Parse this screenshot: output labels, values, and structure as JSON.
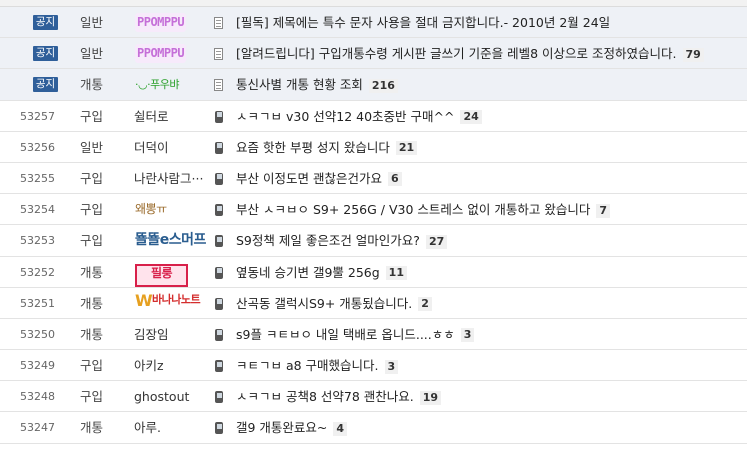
{
  "notices": [
    {
      "badge": "공지",
      "category": "일반",
      "nickname": "PPOMPPU",
      "nick_style": "ppo",
      "icon": "doc-icon",
      "title": "[필독] 제목에는 특수 문자 사용을 절대 금지합니다.- 2010년 2월 24일",
      "comments": ""
    },
    {
      "badge": "공지",
      "category": "일반",
      "nickname": "PPOMPPU",
      "nick_style": "ppo",
      "icon": "doc-icon",
      "title": "[알려드립니다] 구입개통수령 게시판 글쓰기 기준을 레벨8 이상으로 조정하였습니다.",
      "comments": "79"
    },
    {
      "badge": "공지",
      "category": "개통",
      "nickname": "·◡·푸우뱌",
      "nick_style": "emo",
      "icon": "doc-icon",
      "title": "통신사별 개통 현황 조회",
      "comments": "216"
    }
  ],
  "posts": [
    {
      "number": "53257",
      "category": "구입",
      "author": "쉴터로",
      "nick_style": "",
      "title": "ㅅㅋㄱㅂ v30 선약12 40초중반 구매^^",
      "comments": "24"
    },
    {
      "number": "53256",
      "category": "일반",
      "author": "더덕이",
      "nick_style": "",
      "title": "요즘 핫한 부평 성지 왔습니다",
      "comments": "21"
    },
    {
      "number": "53255",
      "category": "구입",
      "author": "나란사람그···",
      "nick_style": "",
      "title": "부산 이정도면 괜찮은건가요",
      "comments": "6"
    },
    {
      "number": "53254",
      "category": "구입",
      "author": "왜뽕ㅠ",
      "nick_style": "emo2",
      "title": "부산 ㅅㅋㅂㅇ S9+ 256G / V30 스트레스 없이 개통하고 왔습니다",
      "comments": "7"
    },
    {
      "number": "53253",
      "category": "구입",
      "author": "뚈뚈e스머프",
      "nick_style": "ttob",
      "title": "S9정책 제일 좋은조건 얼마인가요?",
      "comments": "27"
    },
    {
      "number": "53252",
      "category": "개통",
      "author": "필룽",
      "nick_style": "pilot",
      "title": "옆동네 승기변 갤9뿔 256g",
      "comments": "11"
    },
    {
      "number": "53251",
      "category": "개통",
      "author": "바나나노트",
      "nick_style": "banana",
      "title": "산곡동 갤럭시S9+ 개통됬습니다.",
      "comments": "2"
    },
    {
      "number": "53250",
      "category": "개통",
      "author": "김장임",
      "nick_style": "",
      "title": "s9플 ㅋㅌㅂㅇ 내일 택배로 옵니드....ㅎㅎ",
      "comments": "3"
    },
    {
      "number": "53249",
      "category": "구입",
      "author": "아키z",
      "nick_style": "",
      "title": "ㅋㅌㄱㅂ a8 구매했습니다.",
      "comments": "3"
    },
    {
      "number": "53248",
      "category": "구입",
      "author": "ghostout",
      "nick_style": "",
      "title": "ㅅㅋㄱㅂ 공책8 선약78 괜찬나요.",
      "comments": "19"
    },
    {
      "number": "53247",
      "category": "개통",
      "author": "아루.",
      "nick_style": "",
      "title": "갤9 개통완료요~",
      "comments": "4"
    }
  ],
  "colors": {
    "notice_badge": "#2f5f9a",
    "notice_row": "#eef1f6"
  }
}
